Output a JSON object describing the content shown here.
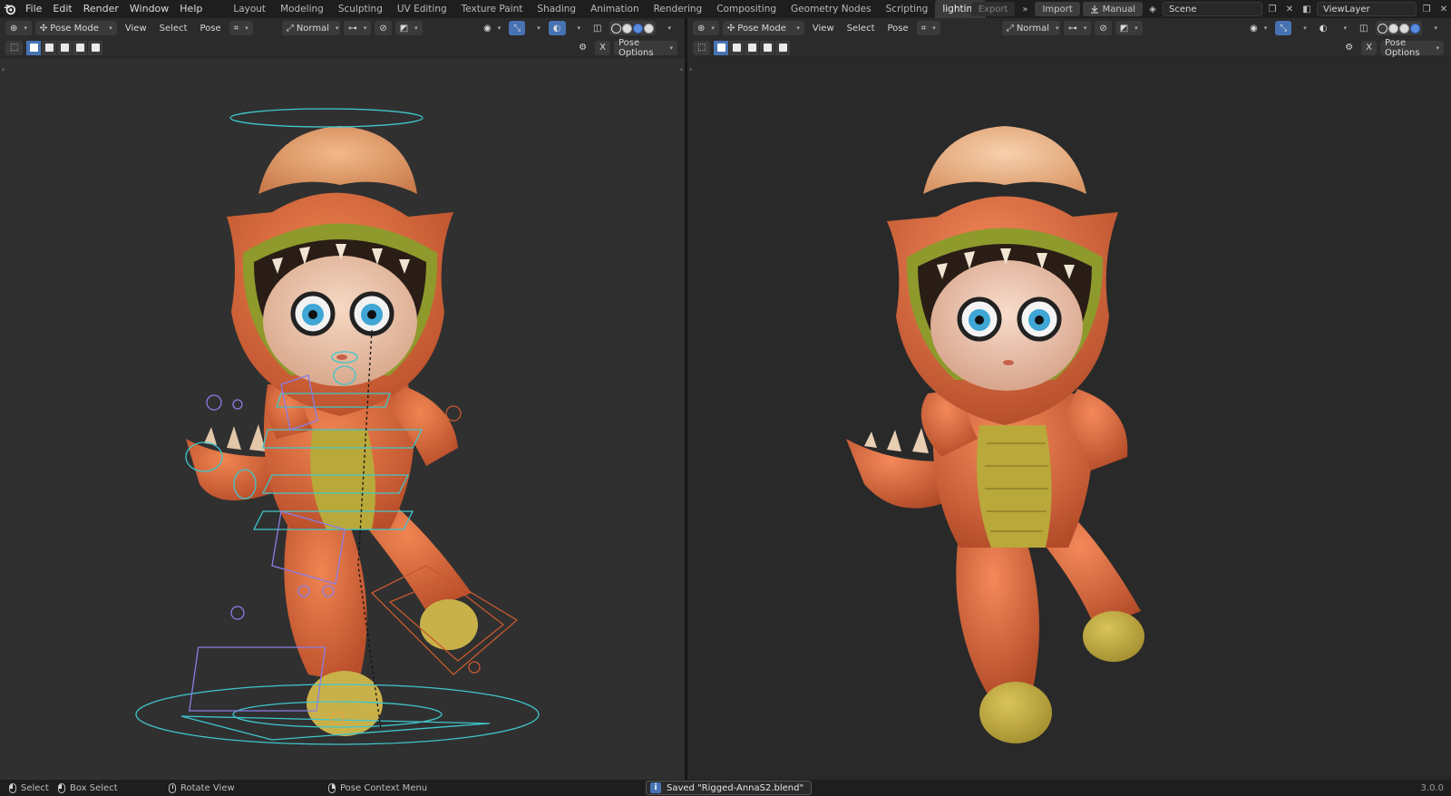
{
  "topbar": {
    "menu": [
      "File",
      "Edit",
      "Render",
      "Window",
      "Help"
    ],
    "tabs": [
      "Layout",
      "Modeling",
      "Sculpting",
      "UV Editing",
      "Texture Paint",
      "Shading",
      "Animation",
      "Rendering",
      "Compositing",
      "Geometry Nodes",
      "Scripting",
      "lighting"
    ],
    "active_tab": "lighting",
    "export_label": "Export",
    "import_label": "Import",
    "manual_label": "Manual",
    "scene": "Scene",
    "view_layer": "ViewLayer"
  },
  "viewport_header": {
    "mode": "Pose Mode",
    "view_menu": "View",
    "select_menu": "Select",
    "pose_menu": "Pose",
    "orientation": "Normal",
    "pose_options": "Pose Options"
  },
  "statusbar": {
    "select": "Select",
    "box_select": "Box Select",
    "rotate_view": "Rotate View",
    "context_menu": "Pose Context Menu",
    "message": "Saved \"Rigged-AnnaS2.blend\"",
    "version": "3.0.0"
  },
  "colors": {
    "accent": "#4772b3",
    "suit": "#e06a3c",
    "belly": "#b9a83a",
    "hair": "#e8a56f",
    "rig_cyan": "#3fc6cc",
    "rig_purple": "#8a7ee6"
  }
}
